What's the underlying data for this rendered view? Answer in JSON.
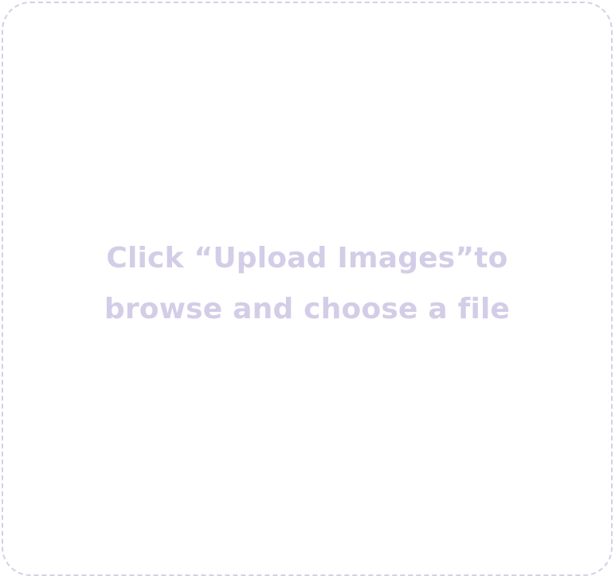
{
  "dropzone": {
    "line1": "Click “Upload Images”to",
    "line2": "browse and choose a file"
  },
  "colors": {
    "border": "#d5d0e6",
    "text": "#d3cde7",
    "background": "#ffffff"
  }
}
